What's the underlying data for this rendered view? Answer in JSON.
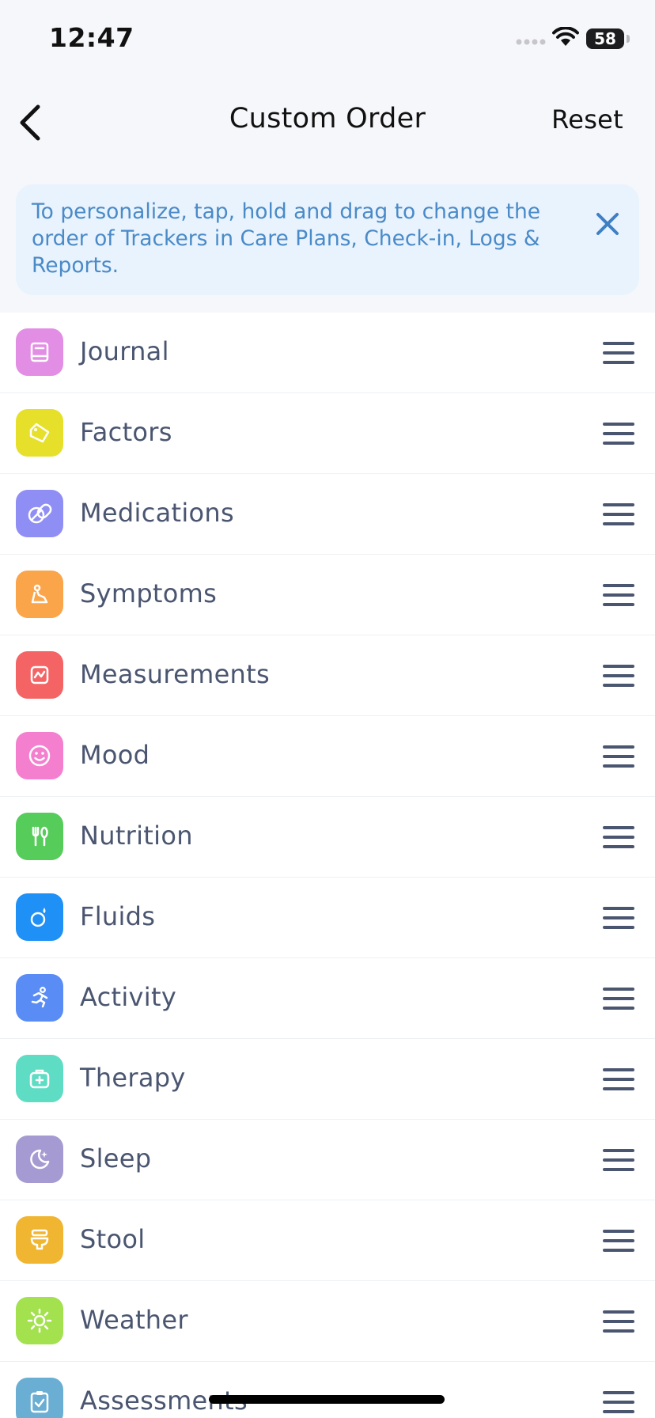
{
  "status_bar": {
    "time": "12:47",
    "battery": "58"
  },
  "nav": {
    "title": "Custom Order",
    "reset_label": "Reset"
  },
  "banner": {
    "text": "To personalize, tap, hold and drag to change the order of Trackers in Care Plans, Check-in, Logs & Reports."
  },
  "trackers": [
    {
      "label": "Journal",
      "icon": "journal-icon",
      "color": "#e38ee5"
    },
    {
      "label": "Factors",
      "icon": "tag-icon",
      "color": "#e6e02a"
    },
    {
      "label": "Medications",
      "icon": "pills-icon",
      "color": "#8f8ef4"
    },
    {
      "label": "Symptoms",
      "icon": "symptom-icon",
      "color": "#fba54b"
    },
    {
      "label": "Measurements",
      "icon": "measurement-icon",
      "color": "#f46464"
    },
    {
      "label": "Mood",
      "icon": "smiley-icon",
      "color": "#f47fcf"
    },
    {
      "label": "Nutrition",
      "icon": "utensils-icon",
      "color": "#56cc5b"
    },
    {
      "label": "Fluids",
      "icon": "drop-icon",
      "color": "#1e90f6"
    },
    {
      "label": "Activity",
      "icon": "runner-icon",
      "color": "#5a8cf5"
    },
    {
      "label": "Therapy",
      "icon": "medical-kit-icon",
      "color": "#5fdcc4"
    },
    {
      "label": "Sleep",
      "icon": "moon-icon",
      "color": "#a59bd2"
    },
    {
      "label": "Stool",
      "icon": "toilet-icon",
      "color": "#f0b632"
    },
    {
      "label": "Weather",
      "icon": "sun-icon",
      "color": "#a3e14e"
    },
    {
      "label": "Assessments",
      "icon": "clipboard-icon",
      "color": "#6aaed3"
    }
  ]
}
